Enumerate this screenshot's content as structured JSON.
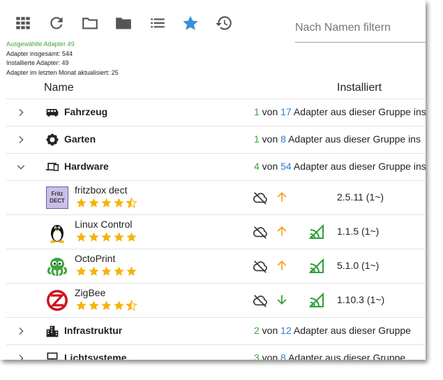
{
  "toolbar": {
    "icons": [
      "grid-icon",
      "refresh-icon",
      "folder-outline-icon",
      "folder-filled-icon",
      "list-icon",
      "star-icon",
      "history-icon"
    ],
    "active_color": "#3b8fd6",
    "filter_placeholder": "Nach Namen filtern"
  },
  "stats": {
    "selected": "Ausgewählte Adapter 49",
    "total": "Adapter insgesamt: 544",
    "installed": "Installierte Adapter: 49",
    "updated": "Adapter im letzten Monat aktualisiert: 25"
  },
  "table": {
    "col_name": "Name",
    "col_installed": "Installiert"
  },
  "groups": [
    {
      "name": "Fahrzeug",
      "count": "1",
      "von": " von ",
      "total": "17",
      "suffix": " Adapter aus dieser Gruppe ins"
    },
    {
      "name": "Garten",
      "count": "1",
      "von": " von ",
      "total": "8",
      "suffix": " Adapter aus dieser Gruppe ins"
    },
    {
      "name": "Hardware",
      "count": "4",
      "von": " von ",
      "total": "54",
      "suffix": " Adapter aus dieser Gruppe ins"
    },
    {
      "name": "Infrastruktur",
      "count": "2",
      "von": " von ",
      "total": "12",
      "suffix": " Adapter aus dieser Gruppe"
    },
    {
      "name": "Lichtsysteme",
      "count": "3",
      "von": " von ",
      "total": "8",
      "suffix": " Adapter aus dieser Gruppe"
    }
  ],
  "adapters": [
    {
      "name": "fritzbox dect",
      "logo_text": "Fritz DECT",
      "rating": 4.5,
      "update": "up",
      "version": "2.5.11 (1~)"
    },
    {
      "name": "Linux Control",
      "rating": 5,
      "update": "up",
      "version": "1.1.5 (1~)"
    },
    {
      "name": "OctoPrint",
      "rating": 5,
      "update": "up",
      "version": "5.1.0 (1~)"
    },
    {
      "name": "ZigBee",
      "rating": 4.5,
      "update": "down",
      "version": "1.10.3 (1~)"
    }
  ],
  "colors": {
    "green": "#3aa63a",
    "blue": "#2a7dd6",
    "star": "#f5b30a",
    "arrow": "#f0a020",
    "signal": "#2e9e3a"
  }
}
